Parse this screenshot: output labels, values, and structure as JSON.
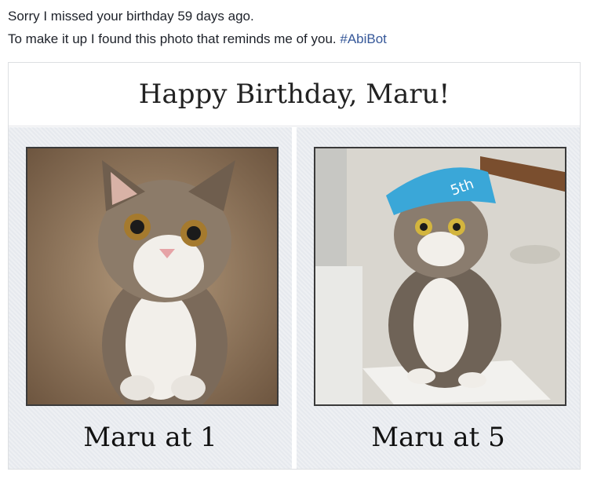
{
  "post": {
    "line1": "Sorry I missed your birthday 59 days ago.",
    "line2_text": "To make it up I found this photo that reminds me of you.",
    "hashtag": "#AbiBot"
  },
  "card": {
    "title": "Happy Birthday, Maru!",
    "panels": [
      {
        "caption": "Maru at 1",
        "image": "kitten-photo"
      },
      {
        "caption": "Maru at 5",
        "image": "cat-with-party-hat-photo",
        "hat_text": "5th"
      }
    ]
  },
  "colors": {
    "text": "#1d2129",
    "hashtag": "#365899",
    "hat": "#3aa7d8"
  }
}
